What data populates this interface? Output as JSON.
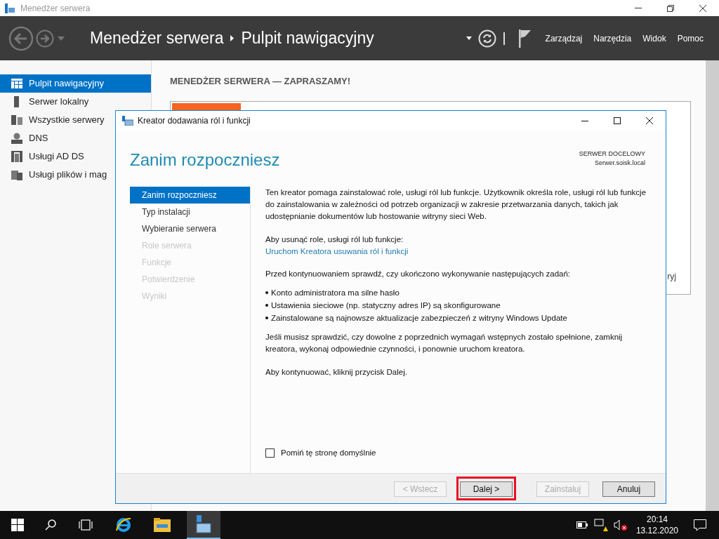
{
  "window": {
    "title": "Menedżer serwera"
  },
  "header": {
    "breadcrumb": [
      "Menedżer serwera",
      "Pulpit nawigacyjny"
    ],
    "menu": [
      "Zarządzaj",
      "Narzędzia",
      "Widok",
      "Pomoc"
    ]
  },
  "sidebar": {
    "items": [
      {
        "label": "Pulpit nawigacyjny",
        "selected": true
      },
      {
        "label": "Serwer lokalny",
        "selected": false
      },
      {
        "label": "Wszystkie serwery",
        "selected": false
      },
      {
        "label": "DNS",
        "selected": false
      },
      {
        "label": "Usługi AD DS",
        "selected": false
      },
      {
        "label": "Usługi plików i mag",
        "selected": false
      }
    ]
  },
  "dashboard": {
    "heading": "MENEDŻER SERWERA — ZAPRASZAMY!",
    "tile_text": "ryj"
  },
  "dialog": {
    "title": "Kreator dodawania ról i funkcji",
    "heading": "Zanim rozpoczniesz",
    "target_label": "SERWER DOCELOWY",
    "target_server": "Serwer.soisk.local",
    "steps": [
      {
        "label": "Zanim rozpoczniesz",
        "selected": true,
        "disabled": false
      },
      {
        "label": "Typ instalacji",
        "selected": false,
        "disabled": false
      },
      {
        "label": "Wybieranie serwera",
        "selected": false,
        "disabled": false
      },
      {
        "label": "Role serwera",
        "selected": false,
        "disabled": true
      },
      {
        "label": "Funkcje",
        "selected": false,
        "disabled": true
      },
      {
        "label": "Potwierdzenie",
        "selected": false,
        "disabled": true
      },
      {
        "label": "Wyniki",
        "selected": false,
        "disabled": true
      }
    ],
    "intro": "Ten kreator pomaga zainstalować role, usługi ról lub funkcje. Użytkownik określa role, usługi ról lub funkcje do zainstalowania w zależności od potrzeb organizacji w zakresie przetwarzania danych, takich jak udostępnianie dokumentów lub hostowanie witryny sieci Web.",
    "remove_label": "Aby usunąć role, usługi ról lub funkcje:",
    "remove_link": "Uruchom Kreatora usuwania ról i funkcji",
    "check_label": "Przed kontynuowaniem sprawdź, czy ukończono wykonywanie następujących zadań:",
    "bullets": [
      "Konto administratora ma silne hasło",
      "Ustawienia sieciowe (np. statyczny adres IP) są skonfigurowane",
      "Zainstalowane są najnowsze aktualizacje zabezpieczeń z witryny Windows Update"
    ],
    "note": "Jeśli musisz sprawdzić, czy dowolne z poprzednich wymagań wstępnych zostało spełnione, zamknij kreatora, wykonaj odpowiednie czynności, i ponownie uruchom kreatora.",
    "continue": "Aby kontynuować, kliknij przycisk Dalej.",
    "skip_checkbox": {
      "label": "Pomiń tę stronę domyślnie",
      "checked": false
    },
    "buttons": [
      {
        "label": "< Wstecz",
        "disabled": true,
        "highlighted": false
      },
      {
        "label": "Dalej >",
        "disabled": false,
        "highlighted": true
      },
      {
        "label": "Zainstaluj",
        "disabled": true,
        "highlighted": false
      },
      {
        "label": "Anuluj",
        "disabled": false,
        "highlighted": false
      }
    ]
  },
  "taskbar": {
    "time": "20:14",
    "date": "13.12.2020"
  }
}
